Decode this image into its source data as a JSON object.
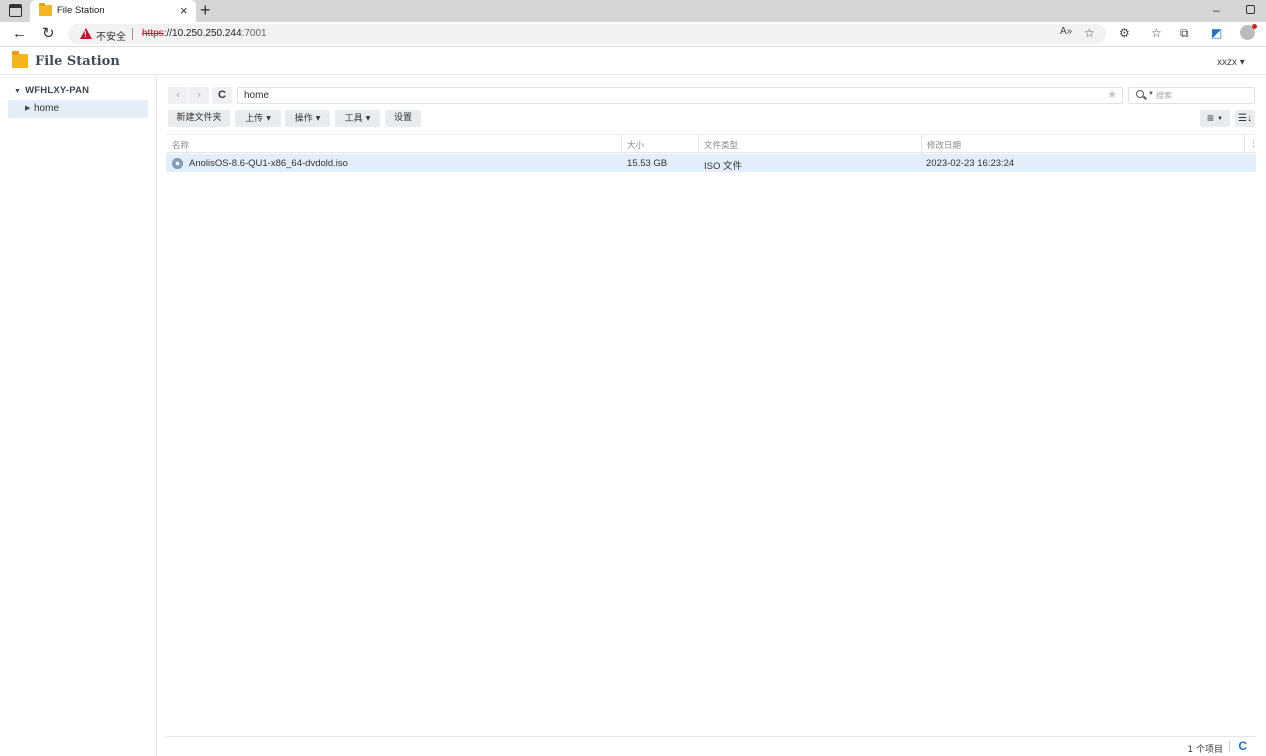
{
  "browser": {
    "tab_title": "File Station",
    "tab_close": "×",
    "new_tab": "+",
    "security_label": "不安全",
    "url_scheme": "https",
    "url_host": "://10.250.250.244",
    "url_port": ":7001",
    "window_minimize": "–"
  },
  "app": {
    "title": "File Station",
    "user": "xxzx ▾"
  },
  "sidebar": {
    "root_label": "WFHLXY-PAN",
    "items": [
      {
        "label": "home"
      }
    ]
  },
  "nav": {
    "back": "‹",
    "forward": "›",
    "refresh": "C",
    "path": "home",
    "search_placeholder": "搜索"
  },
  "toolbar": {
    "new_folder": "新建文件夹",
    "upload": "上传",
    "action": "操作",
    "tools": "工具",
    "settings": "设置"
  },
  "list": {
    "columns": [
      "名称",
      "大小",
      "文件类型",
      "修改日期"
    ],
    "rows": [
      {
        "name": "AnolisOS-8.6-QU1-x86_64-dvdold.iso",
        "size": "15.53 GB",
        "type": "ISO 文件",
        "modified": "2023-02-23 16:23:24"
      }
    ]
  },
  "footer": {
    "count": "1 个项目"
  }
}
